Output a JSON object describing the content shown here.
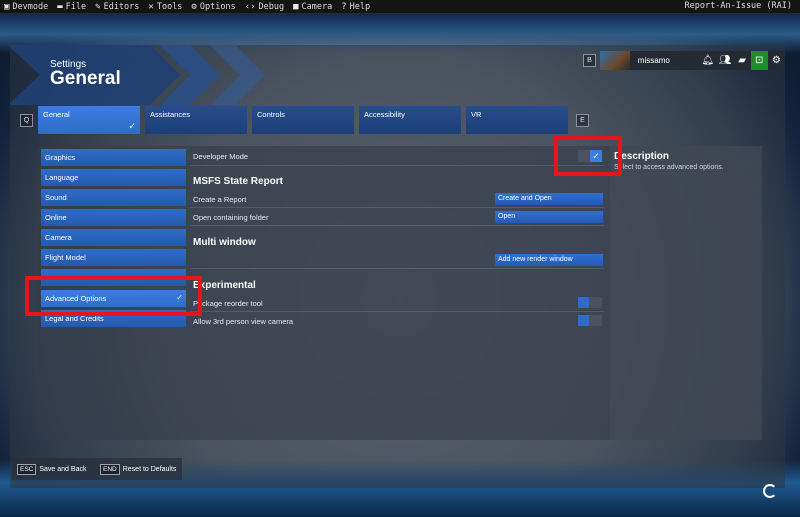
{
  "devbar": {
    "items": [
      {
        "label": "Devmode",
        "icon": "devmode-icon"
      },
      {
        "label": "File",
        "icon": "folder-icon"
      },
      {
        "label": "Editors",
        "icon": "pencil-icon"
      },
      {
        "label": "Tools",
        "icon": "tools-icon"
      },
      {
        "label": "Options",
        "icon": "gear-icon"
      },
      {
        "label": "Debug",
        "icon": "code-icon"
      },
      {
        "label": "Camera",
        "icon": "camera-icon"
      },
      {
        "label": "Help",
        "icon": "help-icon"
      }
    ],
    "report": "Report-An-Issue (RAI)"
  },
  "header": {
    "subtitle": "Settings",
    "title": "General",
    "key_b": "B",
    "key_q": "Q",
    "key_e": "E"
  },
  "user": {
    "name": "missamo",
    "icons": [
      "bell-icon",
      "friends-icon",
      "chat-icon",
      "store-icon",
      "gear-icon"
    ]
  },
  "tabs": [
    {
      "label": "General",
      "active": true
    },
    {
      "label": "Assistances",
      "active": false
    },
    {
      "label": "Controls",
      "active": false
    },
    {
      "label": "Accessibility",
      "active": false
    },
    {
      "label": "VR",
      "active": false
    }
  ],
  "sidebar": [
    {
      "label": "Graphics"
    },
    {
      "label": "Language"
    },
    {
      "label": "Sound"
    },
    {
      "label": "Online"
    },
    {
      "label": "Camera"
    },
    {
      "label": "Flight Model"
    },
    {
      "label": "Advanced Options"
    },
    {
      "label": "Legal and Credits"
    }
  ],
  "settings": {
    "developer_mode": "Developer Mode",
    "state_report_title": "MSFS State Report",
    "create_report": "Create a Report",
    "create_and_open": "Create and Open",
    "open_folder": "Open containing folder",
    "open": "Open",
    "multi_window_title": "Multi window",
    "add_render_window": "Add new render window",
    "experimental_title": "Experimental",
    "package_reorder": "Package reorder tool",
    "third_person_camera": "Allow 3rd person view camera"
  },
  "description": {
    "title": "Description",
    "text": "Select to access advanced options."
  },
  "footer": {
    "esc_key": "ESC",
    "esc_label": "Save and Back",
    "end_key": "END",
    "end_label": "Reset to Defaults"
  },
  "colors": {
    "accent": "#2f6cc9",
    "highlight": "#e8141c"
  }
}
